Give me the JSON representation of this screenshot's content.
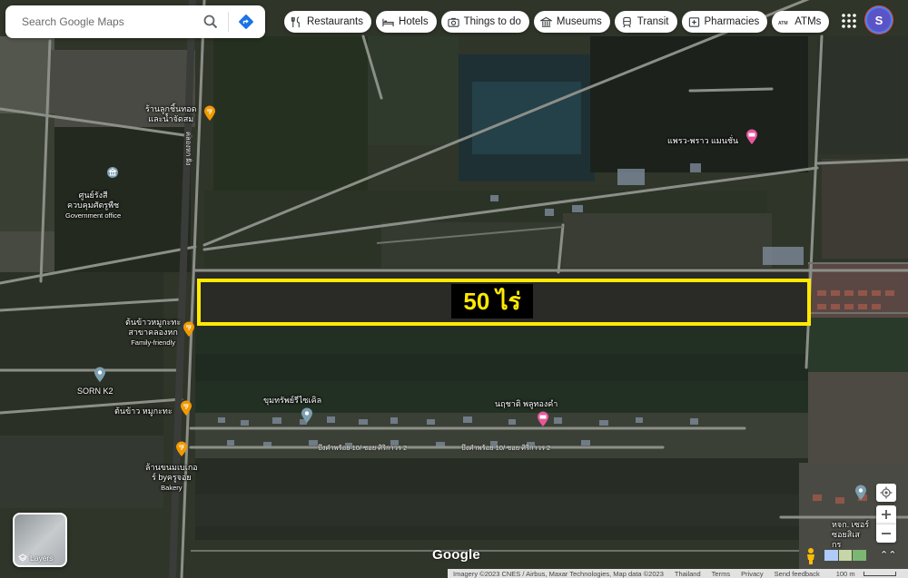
{
  "search": {
    "placeholder": "Search Google Maps"
  },
  "chips": [
    {
      "label": "Restaurants",
      "icon": "fork-knife-icon"
    },
    {
      "label": "Hotels",
      "icon": "bed-icon"
    },
    {
      "label": "Things to do",
      "icon": "camera-icon"
    },
    {
      "label": "Museums",
      "icon": "museum-icon"
    },
    {
      "label": "Transit",
      "icon": "train-icon"
    },
    {
      "label": "Pharmacies",
      "icon": "pharmacy-icon"
    },
    {
      "label": "ATMs",
      "icon": "atm-icon"
    }
  ],
  "account": {
    "initial": "S"
  },
  "places": [
    {
      "name": "ร้านลูกชิ้นทอด\nและน้ำจัดสม",
      "sub": ""
    },
    {
      "name": "ศูนย์รังสี\nควบคุมศัตรูพืช",
      "sub": "Government office"
    },
    {
      "name": "แพรว-พราว แมนชั่น",
      "sub": ""
    },
    {
      "name": "ต้นข้าวหมูกะทะ\nสาขาคลองหก",
      "sub": "Family-friendly"
    },
    {
      "name": "SORN K2",
      "sub": ""
    },
    {
      "name": "ต้นข้าว หมูกะทะ",
      "sub": ""
    },
    {
      "name": "ขุมทรัพย์รีไซเคิล",
      "sub": ""
    },
    {
      "name": "นฤชาติ พลูทองคำ",
      "sub": ""
    },
    {
      "name": "ล้านขนมเบเกอ\nร์ byครูจอย",
      "sub": "Bakery"
    },
    {
      "name": "หจก. เซอร์\nซอยสิเส\nกร",
      "sub": ""
    }
  ],
  "roads": [
    {
      "name": "คลองหก ฝั่ง"
    },
    {
      "name": "บึงคำพร้อย 10/ ซอย ศิริกาวร 2"
    },
    {
      "name": "บึงคำพร้อย 10/ ซอย ศิริกาวร 2"
    }
  ],
  "plot": {
    "label": "50 ไร่",
    "color": "#ffea00"
  },
  "layers": {
    "label": "Layers"
  },
  "brand": "Google",
  "footer": {
    "imagery": "Imagery ©2023 CNES / Airbus, Maxar Technologies, Map data ©2023",
    "country": "Thailand",
    "terms": "Terms",
    "privacy": "Privacy",
    "feedback": "Send feedback",
    "scale": "100 m"
  }
}
